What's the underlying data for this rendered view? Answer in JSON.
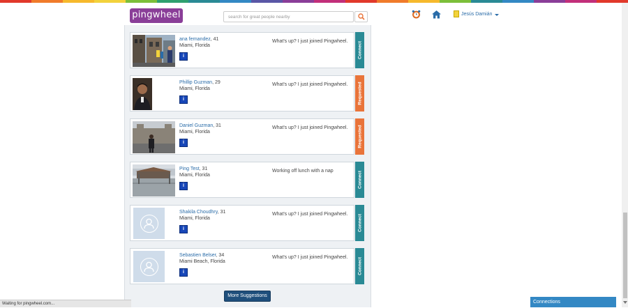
{
  "header": {
    "logo_text": "pingwheel",
    "search_placeholder": "search for great people nearby",
    "user_name": "Jesús Damián"
  },
  "colors": {
    "rainbow": [
      "#e1392b",
      "#f07b2b",
      "#f6b92c",
      "#f2d23c",
      "#7cbf3a",
      "#2fa06f",
      "#2a8a95",
      "#3388c4",
      "#5a57a6",
      "#8a3e98",
      "#c22f7a",
      "#e1392b",
      "#f07b2b",
      "#f6b92c",
      "#7cbf3a",
      "#2a8a95",
      "#3388c4",
      "#8a3e98",
      "#c22f7a",
      "#e1392b"
    ],
    "connect": "#2a8a95",
    "requested": "#e9743a",
    "link": "#2a6ca8"
  },
  "suggestions": [
    {
      "name": "ana fernandez",
      "age": ", 41",
      "location": "Miami, Florida",
      "status": "What's up? I just joined Pingwheel.",
      "action": "Connect",
      "photo": "street-photo"
    },
    {
      "name": "Phillip Guzman",
      "age": ", 29",
      "location": "Miami, Florida",
      "status": "What's up? I just joined Pingwheel.",
      "action": "Requested",
      "photo": "portrait-photo"
    },
    {
      "name": "Daniel Guzman",
      "age": ", 31",
      "location": "Miami, Florida",
      "status": "What's up? I just joined Pingwheel.",
      "action": "Requested",
      "photo": "landmark-photo"
    },
    {
      "name": "Ping Test",
      "age": ", 31",
      "location": "Miami, Florida",
      "status": "Working off lunch with a nap",
      "action": "Connect",
      "photo": "plaza-photo"
    },
    {
      "name": "Shakila Choudhry",
      "age": ", 31",
      "location": "Miami, Florida",
      "status": "What's up? I just joined Pingwheel.",
      "action": "Connect",
      "photo": "placeholder"
    },
    {
      "name": "Sebastien Belser",
      "age": ", 34",
      "location": "Miami Beach, Florida",
      "status": "What's up? I just joined Pingwheel.",
      "action": "Connect",
      "photo": "placeholder"
    }
  ],
  "info_icon_label": "i",
  "more_button": "More Suggestions",
  "statusbar_text": "Waiting for pingwheel.com...",
  "connections_tab": "Connections"
}
